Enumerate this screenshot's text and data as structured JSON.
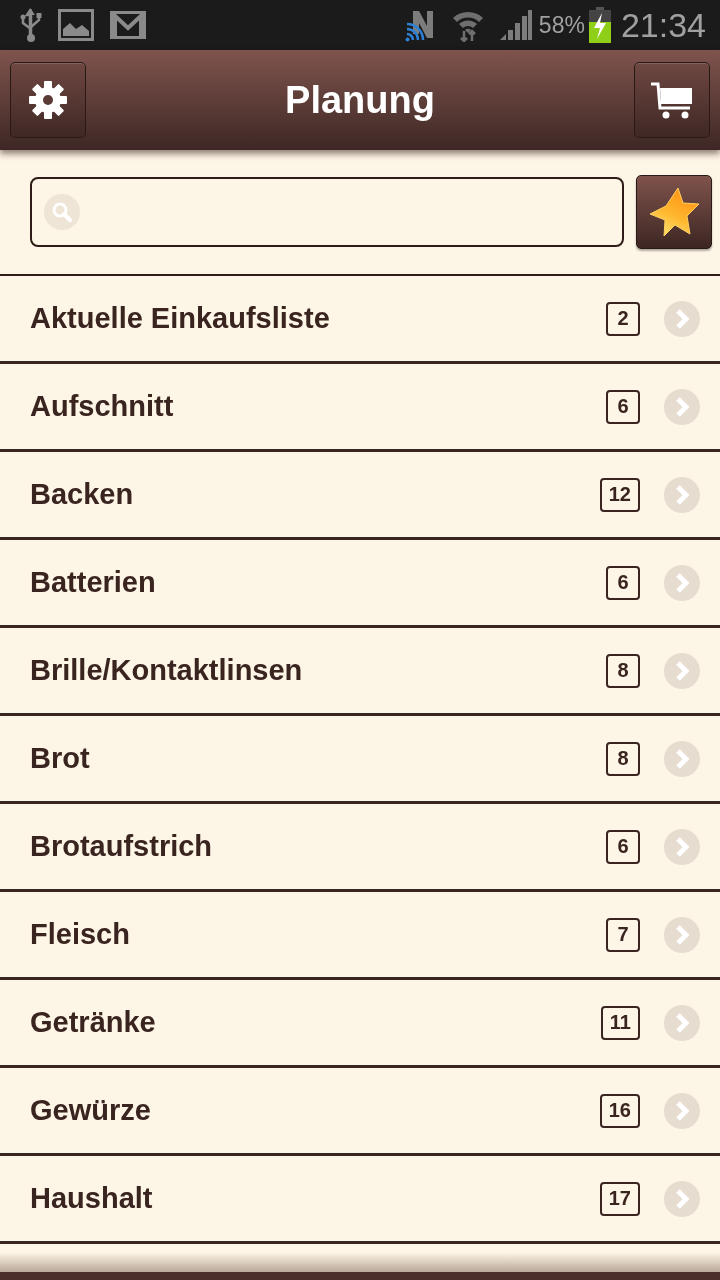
{
  "status_bar": {
    "battery_text": "58%",
    "time": "21:34"
  },
  "header": {
    "title": "Planung"
  },
  "categories": [
    {
      "name": "Aktuelle Einkaufsliste",
      "count": "2"
    },
    {
      "name": "Aufschnitt",
      "count": "6"
    },
    {
      "name": "Backen",
      "count": "12"
    },
    {
      "name": "Batterien",
      "count": "6"
    },
    {
      "name": "Brille/Kontaktlinsen",
      "count": "8"
    },
    {
      "name": "Brot",
      "count": "8"
    },
    {
      "name": "Brotaufstrich",
      "count": "6"
    },
    {
      "name": "Fleisch",
      "count": "7"
    },
    {
      "name": "Getränke",
      "count": "11"
    },
    {
      "name": "Gewürze",
      "count": "16"
    },
    {
      "name": "Haushalt",
      "count": "17"
    }
  ]
}
